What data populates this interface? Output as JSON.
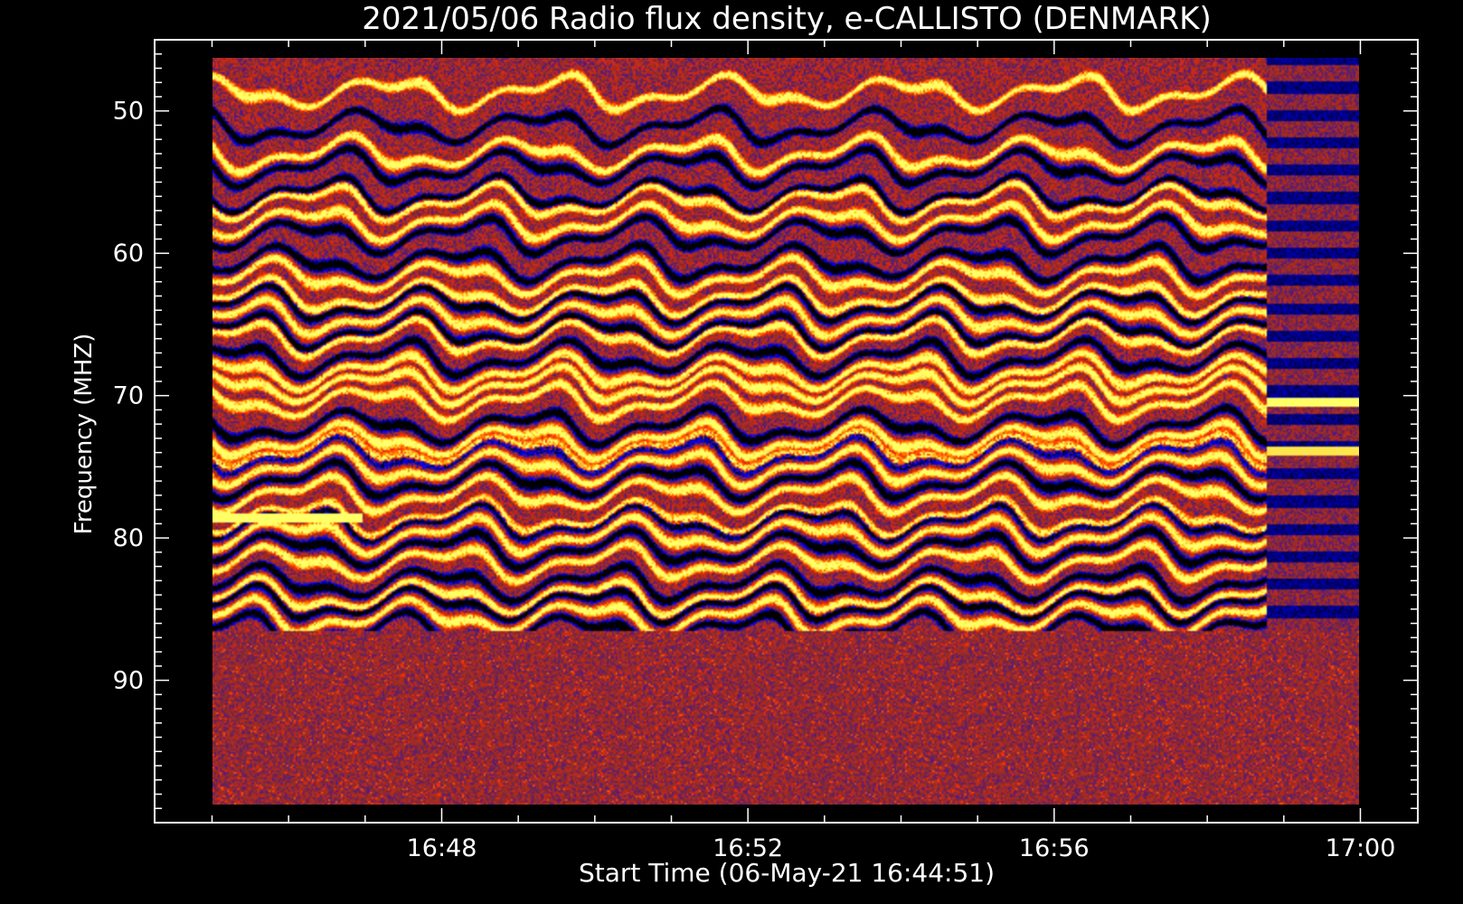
{
  "chart_data": {
    "type": "heatmap",
    "title": "2021/05/06  Radio flux density, e-CALLISTO (DENMARK)",
    "xlabel": "Start Time (06-May-21 16:44:51)",
    "ylabel": "Frequency (MHZ)",
    "x_ticks": [
      "16:48",
      "16:52",
      "16:56",
      "17:00"
    ],
    "x_tick_minutes": [
      1008,
      1012,
      1016,
      1020
    ],
    "x_range_minutes": [
      1004.25,
      1020.75
    ],
    "data_x_minutes": [
      1005.0,
      1020.0
    ],
    "y_ticks": [
      "50",
      "60",
      "70",
      "80",
      "90"
    ],
    "y_tick_values": [
      50,
      60,
      70,
      80,
      90
    ],
    "y_range": [
      45,
      100
    ],
    "data_y_range": [
      45,
      99.7
    ],
    "y_inverted": true,
    "colormap": [
      "#000000",
      "#0000ff",
      "#8a2b2b",
      "#ff2a00",
      "#ff9900",
      "#ffff66"
    ],
    "bright_bands_mhz": [
      47.5,
      52,
      55.5,
      57,
      61,
      62.5,
      64,
      65.5,
      68,
      69,
      70.2,
      73,
      73.8,
      75,
      77,
      78.7,
      80,
      82,
      84.5,
      86
    ],
    "dark_bands_mhz": [
      50,
      53,
      55,
      58,
      60,
      63,
      65,
      67,
      72,
      74,
      76,
      79,
      81,
      83.5,
      85,
      87
    ]
  }
}
